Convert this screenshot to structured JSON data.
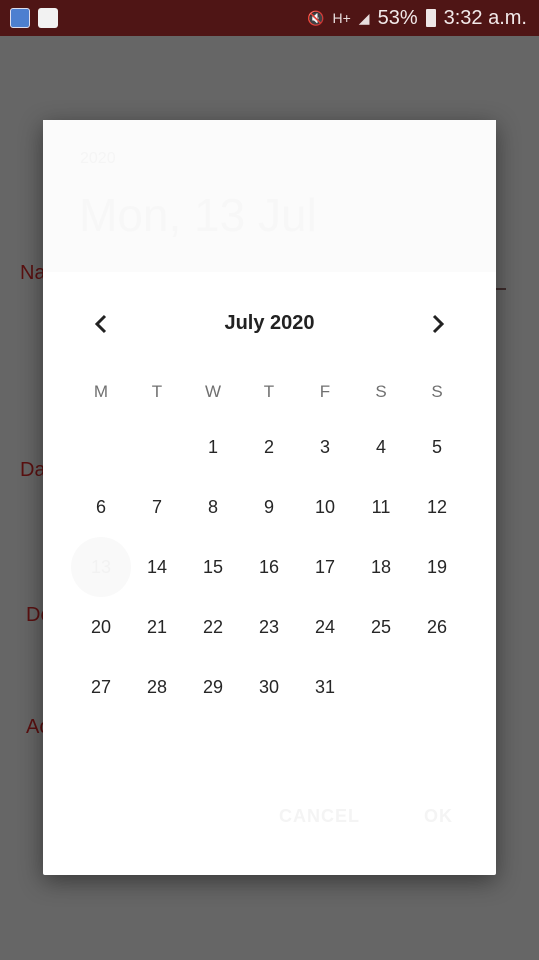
{
  "status_bar": {
    "battery_percent": "53%",
    "time": "3:32 a.m.",
    "network_type": "H+",
    "icons": [
      "app-icon-1",
      "recycle-notification-icon",
      "mute-icon",
      "signal-icon",
      "battery-icon"
    ]
  },
  "background_form": {
    "labels": [
      "Na",
      "Da",
      "De",
      "Ac"
    ]
  },
  "date_picker": {
    "header": {
      "year": "2020",
      "selected_date": "Mon, 13 Jul"
    },
    "month_title": "July 2020",
    "weekdays": [
      "M",
      "T",
      "W",
      "T",
      "F",
      "S",
      "S"
    ],
    "weeks": [
      [
        "",
        "",
        "1",
        "2",
        "3",
        "4",
        "5"
      ],
      [
        "6",
        "7",
        "8",
        "9",
        "10",
        "11",
        "12"
      ],
      [
        "13",
        "14",
        "15",
        "16",
        "17",
        "18",
        "19"
      ],
      [
        "20",
        "21",
        "22",
        "23",
        "24",
        "25",
        "26"
      ],
      [
        "27",
        "28",
        "29",
        "30",
        "31",
        "",
        ""
      ]
    ],
    "selected_day": "13",
    "buttons": {
      "cancel": "CANCEL",
      "ok": "OK"
    }
  },
  "colors": {
    "status_bar": "#4f1515",
    "scrim": "#666666",
    "dialog": "#ffffff",
    "form_label": "#5a1010"
  }
}
